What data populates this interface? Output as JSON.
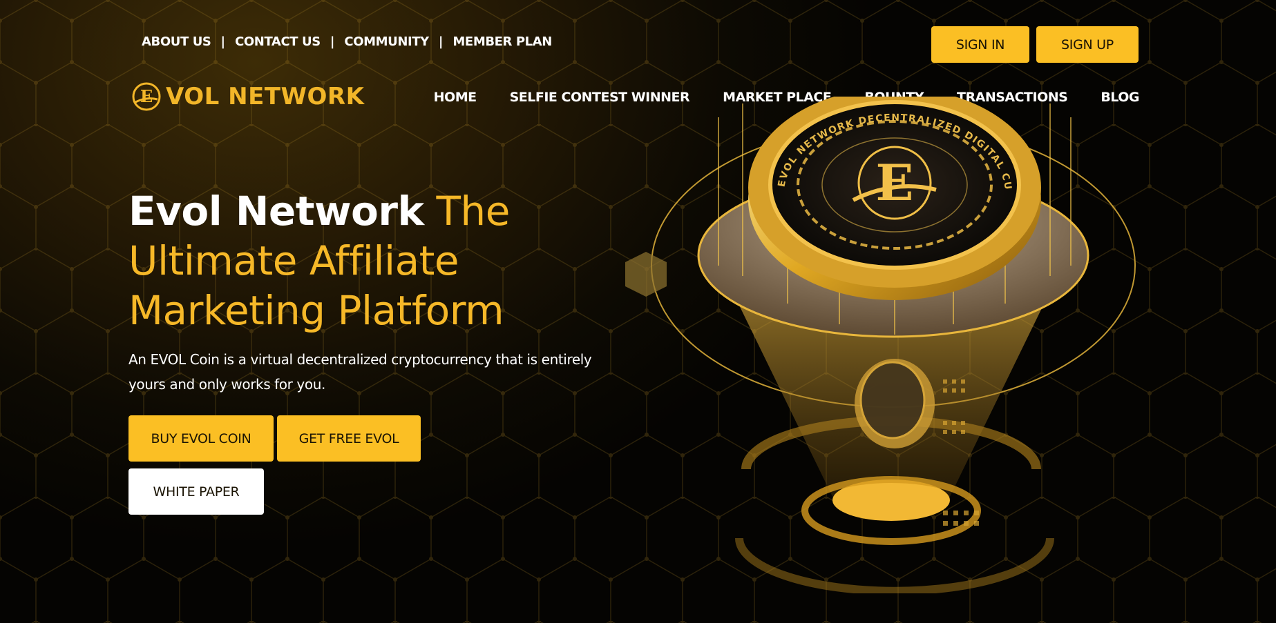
{
  "top_links": {
    "about": "ABOUT US",
    "contact": "CONTACT US",
    "community": "COMMUNITY",
    "member_plan": "MEMBER PLAN",
    "separator": "|"
  },
  "auth": {
    "sign_in": "SIGN IN",
    "sign_up": "SIGN UP"
  },
  "logo": {
    "text": "VOL NETWORK",
    "emblem_letter": "E"
  },
  "nav": {
    "home": "HOME",
    "selfie": "SELFIE CONTEST WINNER",
    "market": "MARKET PLACE",
    "bounty": "BOUNTY",
    "transactions": "TRANSACTIONS",
    "blog": "BLOG"
  },
  "hero": {
    "title_white": "Evol Network",
    "title_yellow_1": " The",
    "title_yellow_2": "Ultimate Affiliate",
    "title_yellow_3": "Marketing Platform",
    "description": "An EVOL Coin is a virtual decentralized cryptocurrency that is entirely yours and only works for you."
  },
  "cta": {
    "buy": "BUY EVOL COIN",
    "free": "GET FREE EVOL",
    "white_paper": "WHITE PAPER"
  },
  "coin": {
    "ring_text": "EVOL NETWORK DECENTRALIZED DIGITAL CURRENCY",
    "letter": "E"
  },
  "colors": {
    "accent": "#fbbf24",
    "gold": "#f2b629",
    "background": "#1e1604"
  }
}
